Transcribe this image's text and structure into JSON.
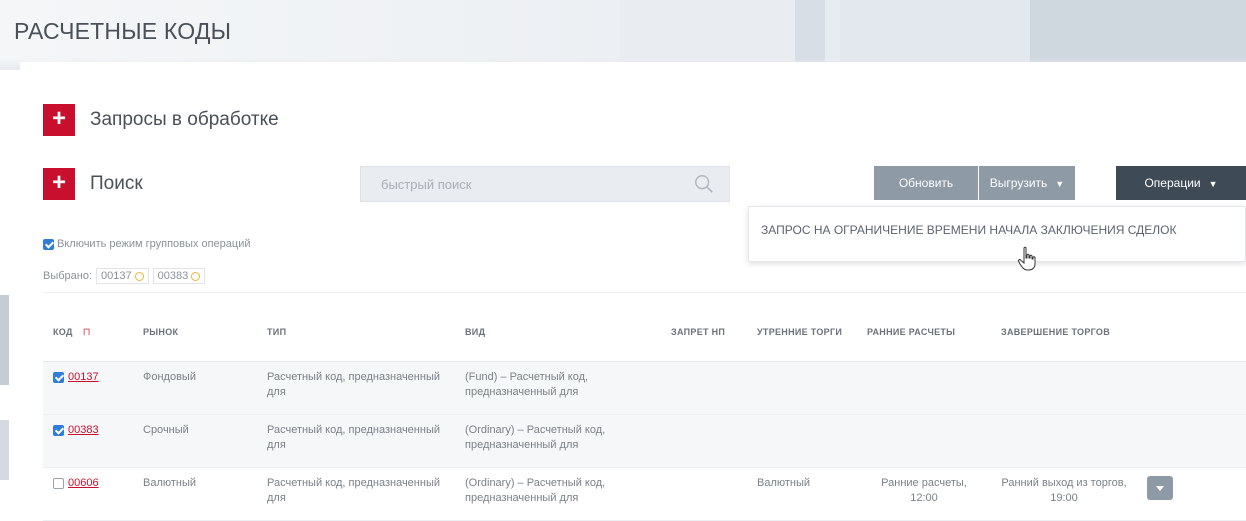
{
  "page": {
    "title": "РАСЧЕТНЫЕ КОДЫ"
  },
  "sections": {
    "requests": {
      "label": "Запросы в обработке",
      "toggle": "+"
    },
    "search": {
      "label": "Поиск",
      "toggle": "+"
    }
  },
  "search": {
    "placeholder": "быстрый поиск",
    "icon": "search-icon"
  },
  "toolbar": {
    "update_label": "Обновить",
    "export_label": "Выгрузить",
    "operations_label": "Операции",
    "caret": "▼"
  },
  "dropdown": {
    "items": [
      "ЗАПРОС НА ОГРАНИЧЕНИЕ ВРЕМЕНИ НАЧАЛА ЗАКЛЮЧЕНИЯ СДЕЛОК"
    ]
  },
  "group_mode": {
    "label": "Включить режим групповых операций",
    "checked": true
  },
  "selected": {
    "label": "Выбрано:",
    "tags": [
      "00137",
      "00383"
    ]
  },
  "table": {
    "headers": [
      "КОД",
      "РЫНОК",
      "ТИП",
      "ВИД",
      "ЗАПРЕТ НП",
      "УТРЕННИЕ ТОРГИ",
      "РАННИЕ РАСЧЕТЫ",
      "ЗАВЕРШЕНИЕ ТОРГОВ",
      ""
    ],
    "rows": [
      {
        "checked": true,
        "code": "00137",
        "market": "Фондовый",
        "type": "Расчетный код, предназначенный для",
        "kind": "(Fund) – Расчетный код, предназначенный для",
        "ban": "",
        "morning": "",
        "early": "",
        "finish": "",
        "has_action": false
      },
      {
        "checked": true,
        "code": "00383",
        "market": "Срочный",
        "type": "Расчетный код, предназначенный для",
        "kind": "(Ordinary) – Расчетный код, предназначенный для",
        "ban": "",
        "morning": "",
        "early": "",
        "finish": "",
        "has_action": false
      },
      {
        "checked": false,
        "code": "00606",
        "market": "Валютный",
        "type": "Расчетный код, предназначенный для",
        "kind": "(Ordinary) – Расчетный код, предназначенный для",
        "ban": "",
        "morning": "Валютный",
        "early": "Ранние расчеты, 12:00",
        "finish": "Ранний выход из торгов, 19:00",
        "has_action": true
      }
    ]
  },
  "colors": {
    "accent": "#c8102e",
    "button_gray": "#8e9aa6",
    "button_dark": "#3e4a56",
    "check_blue": "#2f7dd6"
  }
}
